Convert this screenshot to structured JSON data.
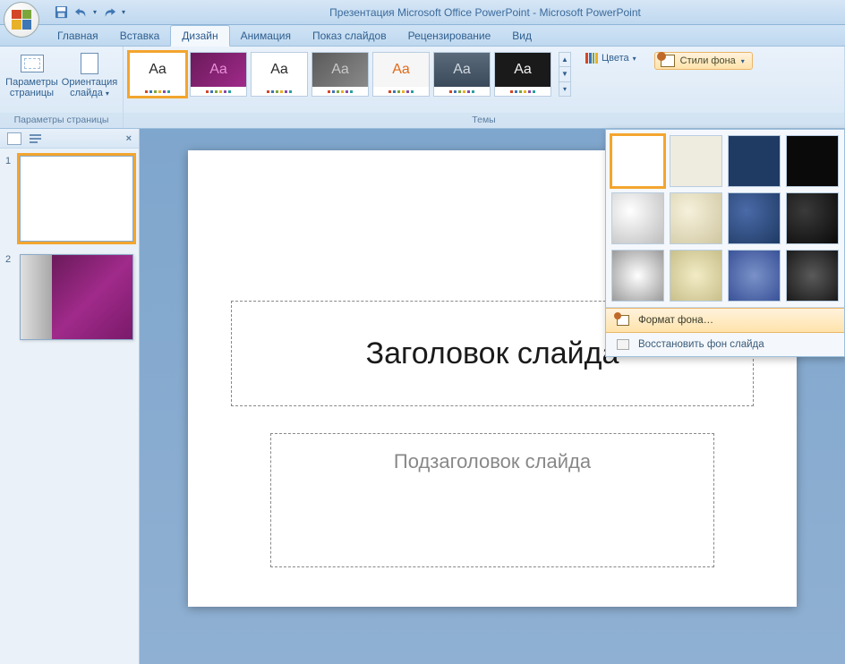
{
  "titlebar": {
    "doc_title": "Презентация Microsoft Office PowerPoint - Microsoft PowerPoint"
  },
  "tabs": {
    "items": [
      {
        "label": "Главная"
      },
      {
        "label": "Вставка"
      },
      {
        "label": "Дизайн",
        "active": true
      },
      {
        "label": "Анимация"
      },
      {
        "label": "Показ слайдов"
      },
      {
        "label": "Рецензирование"
      },
      {
        "label": "Вид"
      }
    ]
  },
  "ribbon": {
    "group_page": {
      "label": "Параметры страницы",
      "btn_pagesetup": "Параметры страницы",
      "btn_orientation": "Ориентация слайда"
    },
    "group_themes": {
      "label": "Темы",
      "items": [
        {
          "name": "theme-office",
          "bg": "#ffffff",
          "fg": "#2a2a2a",
          "selected": true
        },
        {
          "name": "theme-purple",
          "bg": "linear-gradient(135deg,#6a1a5a,#a02a8a)",
          "fg": "#e890d8"
        },
        {
          "name": "theme-white2",
          "bg": "#ffffff",
          "fg": "#2a2a2a"
        },
        {
          "name": "theme-gray",
          "bg": "linear-gradient(135deg,#5a5a5a,#8a8a8a)",
          "fg": "#c8c8c8"
        },
        {
          "name": "theme-orange",
          "bg": "#f6f6f6",
          "fg": "#e06a1a"
        },
        {
          "name": "theme-slate",
          "bg": "linear-gradient(#5a6a7a,#3a4a5a)",
          "fg": "#d0d8e0"
        },
        {
          "name": "theme-black",
          "bg": "#1a1a1a",
          "fg": "#f0f0f0"
        }
      ]
    },
    "right": {
      "colors_label": "Цвета",
      "bgstyles_label": "Стили фона"
    }
  },
  "slidelist": {
    "thumbs": [
      {
        "num": "1"
      },
      {
        "num": "2"
      }
    ]
  },
  "slide": {
    "title_placeholder": "Заголовок слайда",
    "subtitle_placeholder": "Подзаголовок слайда"
  },
  "popup": {
    "swatches": [
      {
        "style": "background:#ffffff",
        "selected": true
      },
      {
        "style": "background:#eeecdf"
      },
      {
        "style": "background:#1f3a63"
      },
      {
        "style": "background:#0a0a0a"
      },
      {
        "style": "background:radial-gradient(circle at 35% 35%,#fff,#bdbdbd)"
      },
      {
        "style": "background:radial-gradient(circle at 35% 35%,#f6f1dc,#cfc6a0)"
      },
      {
        "style": "background:radial-gradient(circle at 35% 35%,#4a6aa8,#1f3a63)"
      },
      {
        "style": "background:radial-gradient(circle at 35% 35%,#3a3a3a,#0a0a0a)"
      },
      {
        "style": "background:radial-gradient(circle at 50% 50%,#fff,#9a9a9a)"
      },
      {
        "style": "background:radial-gradient(circle at 50% 50%,#f2ecc6,#c8bf8a)"
      },
      {
        "style": "background:radial-gradient(circle at 50% 50%,#7a92c8,#3a5298)"
      },
      {
        "style": "background:radial-gradient(circle at 50% 50%,#5a5a5a,#1a1a1a)"
      }
    ],
    "format_bg": "Формат фона…",
    "reset_bg": "Восстановить фон слайда"
  }
}
